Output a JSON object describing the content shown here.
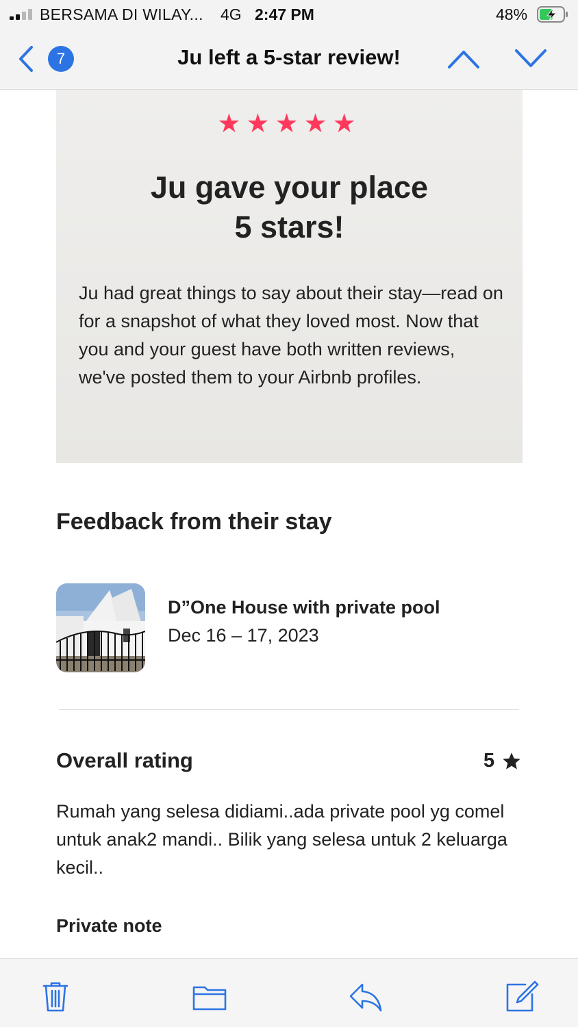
{
  "status_bar": {
    "carrier": "BERSAMA DI WILAY...",
    "network": "4G",
    "time": "2:47 PM",
    "battery": "48%"
  },
  "nav": {
    "unread_count": "7",
    "title": "Ju left a 5-star review!"
  },
  "hero": {
    "stars": "★★★★★",
    "title_line1": "Ju gave your place",
    "title_line2": "5 stars!",
    "body": "Ju had great things to say about their stay—read on for a snapshot of what they loved most. Now that you and your guest have both written reviews, we've posted them to your Airbnb profiles."
  },
  "feedback": {
    "heading": "Feedback from their stay",
    "listing_name": "D”One House with private pool",
    "dates": "Dec 16 – 17, 2023",
    "overall_label": "Overall rating",
    "overall_value": "5",
    "review": "Rumah yang selesa didiami..ada private pool yg comel untuk anak2 mandi.. Bilik yang selesa untuk 2 keluarga kecil..",
    "private_note_label": "Private note"
  },
  "colors": {
    "accent_blue": "#2c74e4",
    "airbnb_pink": "#ff385c",
    "hero_bg": "#efeeec"
  },
  "icons": {
    "toolbar": [
      "trash-icon",
      "folder-icon",
      "reply-icon",
      "compose-icon"
    ]
  }
}
